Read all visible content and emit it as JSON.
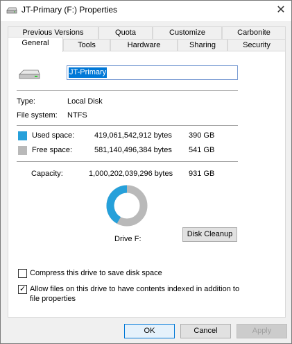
{
  "window": {
    "title": "JT-Primary (F:) Properties",
    "close_glyph": "✕"
  },
  "tabs": {
    "row1": [
      "Previous Versions",
      "Quota",
      "Customize",
      "Carbonite"
    ],
    "row2": [
      "General",
      "Tools",
      "Hardware",
      "Sharing",
      "Security"
    ],
    "active": "General"
  },
  "general": {
    "drive_name": "JT-Primary",
    "type_label": "Type:",
    "type_value": "Local Disk",
    "fs_label": "File system:",
    "fs_value": "NTFS",
    "used_label": "Used space:",
    "used_bytes": "419,061,542,912 bytes",
    "used_gb": "390 GB",
    "free_label": "Free space:",
    "free_bytes": "581,140,496,384 bytes",
    "free_gb": "541 GB",
    "capacity_label": "Capacity:",
    "capacity_bytes": "1,000,202,039,296 bytes",
    "capacity_gb": "931 GB",
    "drive_label": "Drive F:",
    "disk_cleanup_label": "Disk Cleanup",
    "used_fraction": 0.419,
    "compress_label": "Compress this drive to save disk space",
    "compress_checked": false,
    "index_label_line1": "Allow files on this drive to have contents indexed in addition to",
    "index_label_line2": "file properties",
    "index_checked": true
  },
  "colors": {
    "used": "#26a0da",
    "free": "#b9b9b9",
    "accent": "#0078d7"
  },
  "buttons": {
    "ok": "OK",
    "cancel": "Cancel",
    "apply": "Apply"
  }
}
